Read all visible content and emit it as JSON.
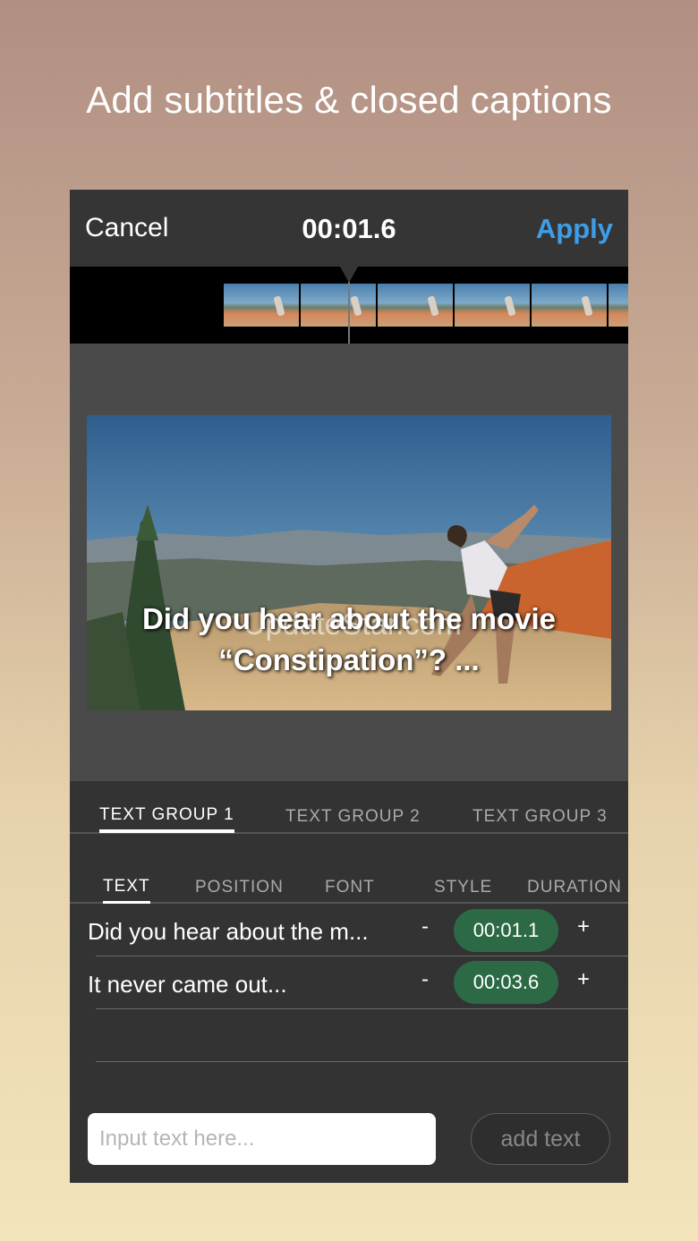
{
  "headline": "Add subtitles & closed captions",
  "topbar": {
    "cancel_label": "Cancel",
    "timecode": "00:01.6",
    "apply_label": "Apply"
  },
  "preview": {
    "caption_line1": "Did you hear about the movie",
    "caption_line2": "“Constipation”? ...",
    "watermark": "UpdateStar.com"
  },
  "group_tabs": [
    {
      "label": "TEXT GROUP 1",
      "active": true
    },
    {
      "label": "TEXT GROUP 2",
      "active": false
    },
    {
      "label": "TEXT GROUP 3",
      "active": false
    }
  ],
  "sub_tabs": [
    {
      "label": "TEXT",
      "active": true
    },
    {
      "label": "POSITION",
      "active": false
    },
    {
      "label": "FONT",
      "active": false
    },
    {
      "label": "STYLE",
      "active": false
    },
    {
      "label": "DURATION",
      "active": false
    }
  ],
  "text_rows": [
    {
      "text": "Did you hear about the m...",
      "minus": "-",
      "duration": "00:01.1",
      "plus": "+"
    },
    {
      "text": "It never came out...",
      "minus": "-",
      "duration": "00:03.6",
      "plus": "+"
    }
  ],
  "input": {
    "placeholder": "Input text here..."
  },
  "add_button_label": "add text",
  "colors": {
    "accent": "#3d9ee8",
    "duration_pill": "#2b6a45",
    "panel": "#333333"
  }
}
